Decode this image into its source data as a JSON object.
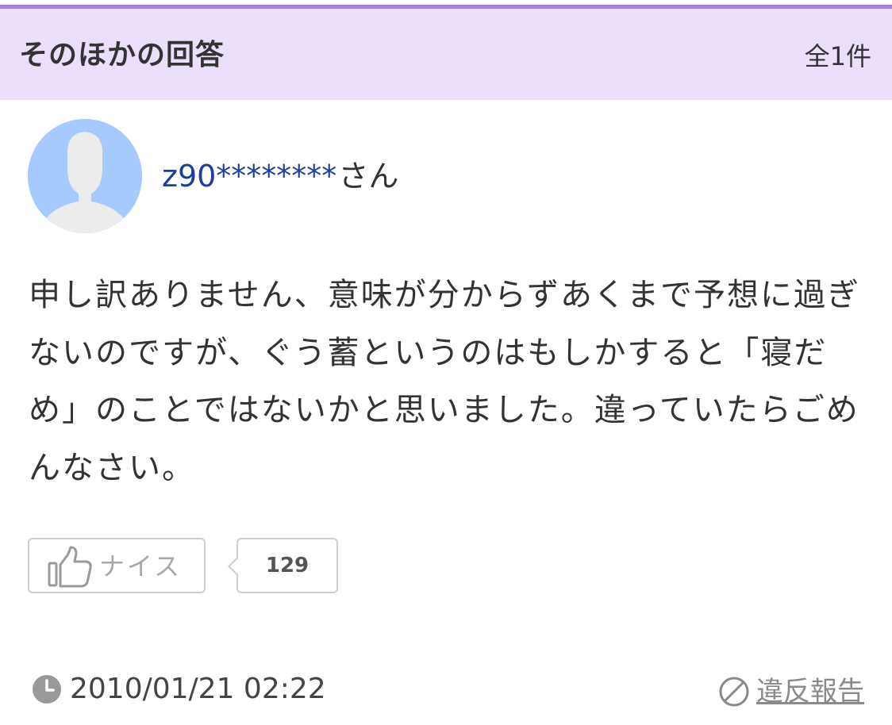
{
  "section": {
    "title": "そのほかの回答",
    "count_label": "全1件"
  },
  "answer": {
    "user": {
      "name": "z90********",
      "honorific": "さん",
      "avatar_icon": "default-user-avatar"
    },
    "body": "申し訳ありません、意味が分からずあくまで予想に過ぎないのですが、ぐう蓄というのはもしかすると「寝だめ」のことではないかと思いました。違っていたらごめんなさい。",
    "nice": {
      "label": "ナイス",
      "count": "129",
      "icon": "thumbs-up-icon"
    },
    "timestamp": "2010/01/21 02:22",
    "report_label": "違反報告"
  },
  "colors": {
    "header_bg": "#ebdffb",
    "header_rule": "#9f7fe0",
    "username": "#1c3f9e",
    "avatar_bg": "#a6cafd"
  }
}
